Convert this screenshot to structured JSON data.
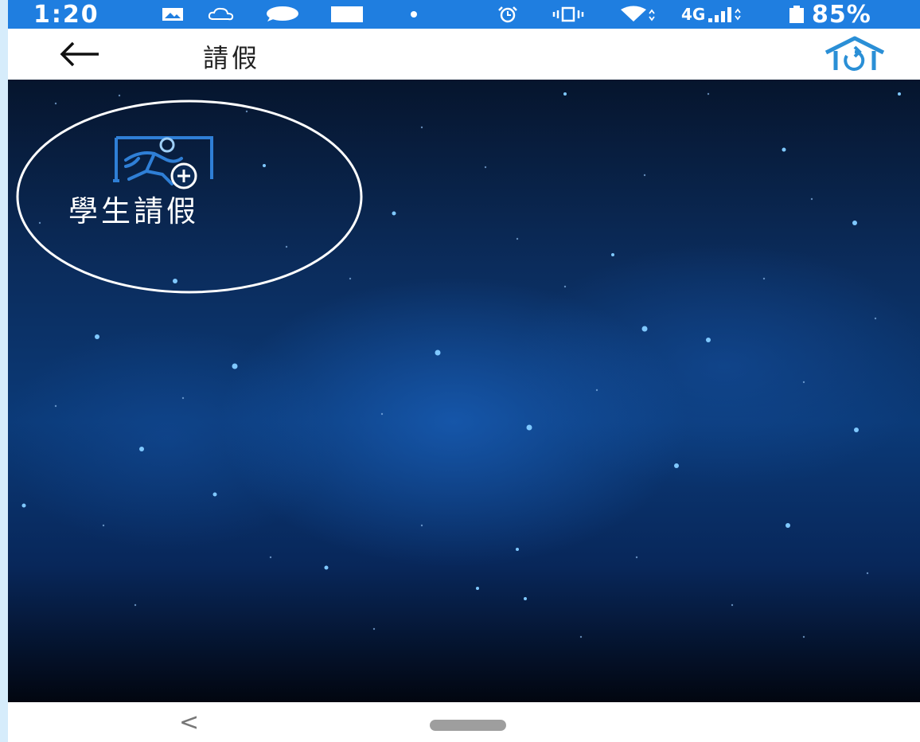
{
  "status_bar": {
    "time": "1:20",
    "network": "4G",
    "battery": "85%",
    "icons": [
      "image-icon",
      "cloud-icon",
      "chat-icon",
      "square-icon",
      "dot-icon",
      "alarm-icon",
      "vibrate-icon",
      "wifi-icon",
      "signal-icon",
      "battery-icon"
    ]
  },
  "app_bar": {
    "title": "請假",
    "back_icon": "arrow-left-icon",
    "home_icon": "home-icon"
  },
  "main": {
    "tiles": [
      {
        "label": "學生請假",
        "icon": "student-leave-icon"
      }
    ]
  },
  "nav_bar": {
    "back_glyph": "<",
    "home_pill": "home-pill"
  },
  "colors": {
    "status_bar": "#1f7ee0",
    "background_top": "#06152d",
    "background_mid": "#0b3a78",
    "icon_blue": "#2f7fd6",
    "home_icon": "#2a8fd6"
  }
}
